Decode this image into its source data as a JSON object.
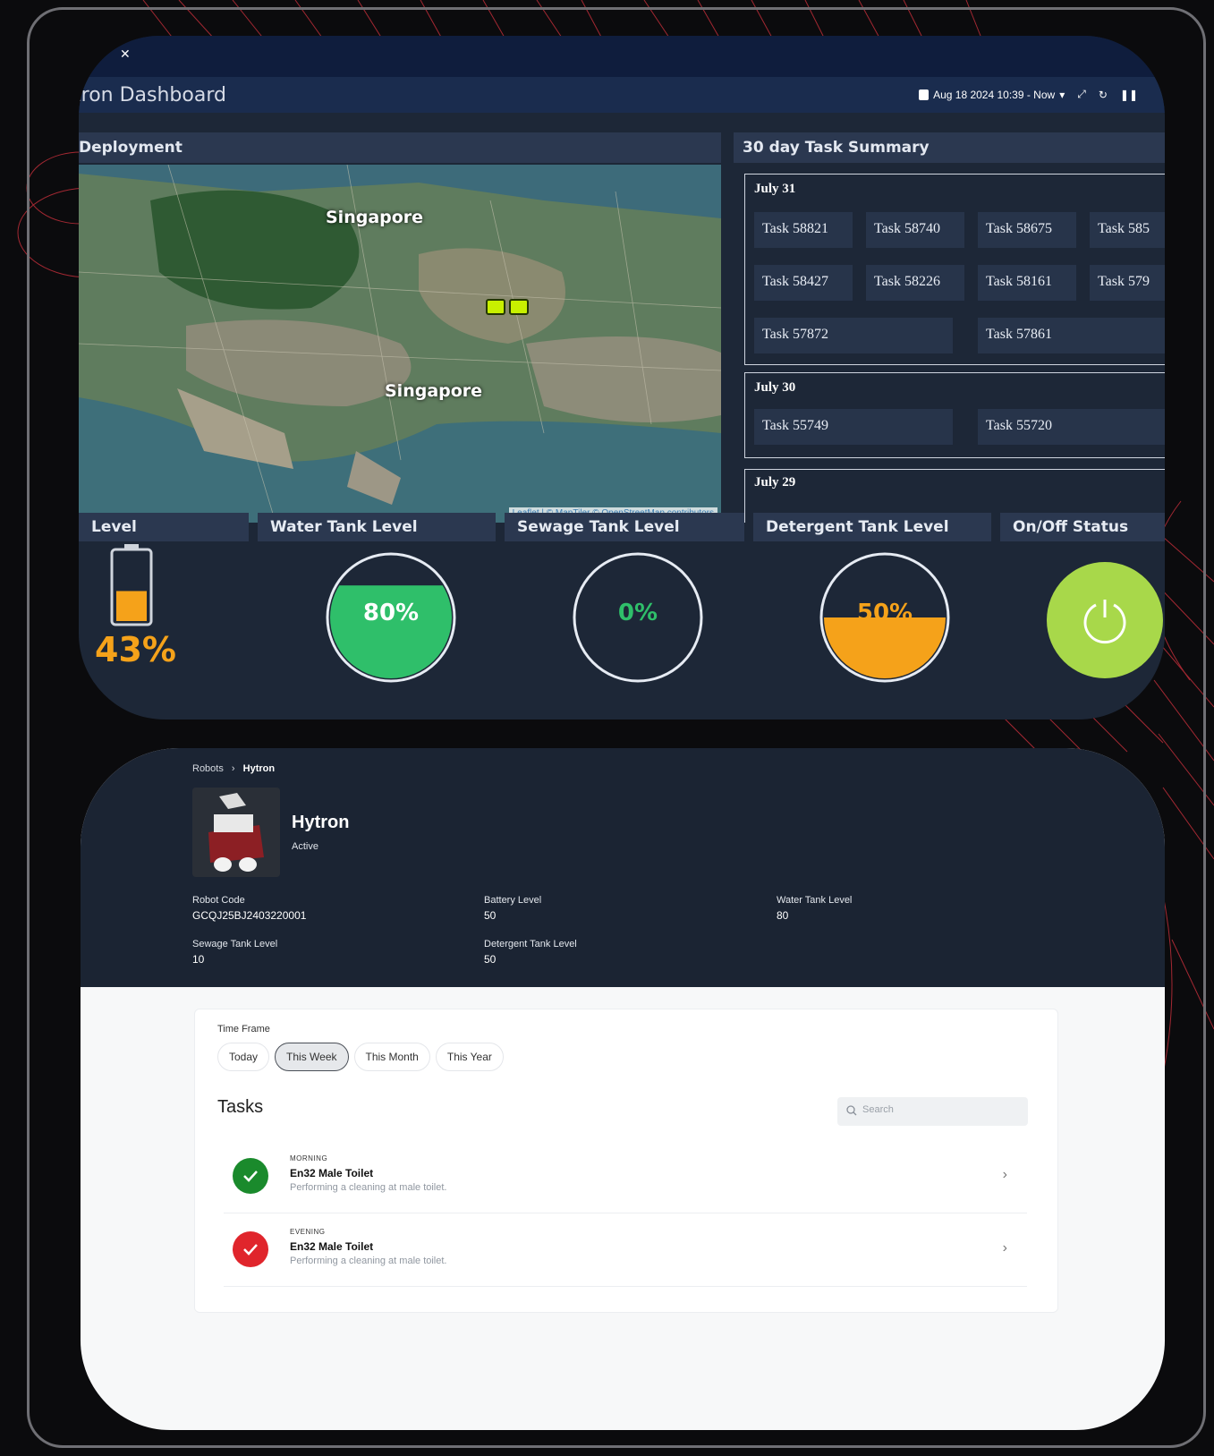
{
  "dashboard": {
    "title": "tron Dashboard",
    "time_range": "Aug 18 2024 10:39 - Now",
    "panels": {
      "deployment": "Deployment",
      "task_summary": "30 day Task Summary"
    },
    "map": {
      "label_top": "Singapore",
      "label_mid": "Singapore",
      "attribution": "Leaflet | © MapTiler © OpenStreetMap contributors"
    },
    "days": [
      {
        "title": "July 31",
        "tasks": [
          "Task 58821",
          "Task 58740",
          "Task 58675",
          "Task 585",
          "Task 58427",
          "Task 58226",
          "Task 58161",
          "Task 579",
          "Task 57872",
          "Task 57861"
        ]
      },
      {
        "title": "July 30",
        "tasks": [
          "Task 55749",
          "Task 55720"
        ]
      },
      {
        "title": "July 29",
        "tasks": []
      }
    ],
    "gauges": {
      "battery_head": "Level",
      "battery_pct": "43%",
      "battery_value": 43,
      "water_head": "Water Tank Level",
      "water_pct": "80%",
      "water_value": 80,
      "sewage_head": "Sewage Tank Level",
      "sewage_pct": "0%",
      "sewage_value": 0,
      "detergent_head": "Detergent Tank Level",
      "detergent_pct": "50%",
      "detergent_value": 50,
      "onoff_head": "On/Off Status"
    },
    "colors": {
      "water": "#2fbf6a",
      "detergent": "#f5a21a",
      "battery": "#f5a21a",
      "power": "#a8d84a"
    }
  },
  "robot": {
    "breadcrumb_root": "Robots",
    "breadcrumb_current": "Hytron",
    "name": "Hytron",
    "status": "Active",
    "stats": {
      "robot_code_label": "Robot Code",
      "robot_code": "GCQJ25BJ2403220001",
      "battery_label": "Battery Level",
      "battery": "50",
      "water_label": "Water Tank Level",
      "water": "80",
      "sewage_label": "Sewage Tank Level",
      "sewage": "10",
      "detergent_label": "Detergent Tank Level",
      "detergent": "50"
    },
    "time_frame_label": "Time Frame",
    "time_frames": [
      "Today",
      "This Week",
      "This Month",
      "This Year"
    ],
    "time_frame_selected": "This Week",
    "tasks_title": "Tasks",
    "search_placeholder": "Search",
    "tasks": [
      {
        "time": "MORNING",
        "title": "En32 Male Toilet",
        "desc": "Performing a cleaning at male toilet.",
        "color": "#1a8a2c"
      },
      {
        "time": "EVENING",
        "title": "En32 Male Toilet",
        "desc": "Performing a cleaning at male toilet.",
        "color": "#e0252c"
      }
    ]
  }
}
